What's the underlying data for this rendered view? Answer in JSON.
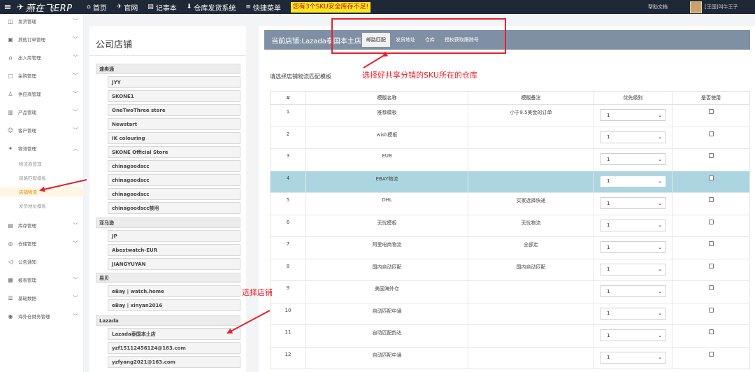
{
  "topbar": {
    "logo_text": "燕在飞ERP",
    "nav": [
      {
        "icon": "home-icon",
        "label": "首页"
      },
      {
        "icon": "paper-plane-icon",
        "label": "官网"
      },
      {
        "icon": "notebook-icon",
        "label": "记事本"
      },
      {
        "icon": "download-icon",
        "label": "仓库发货系统"
      },
      {
        "icon": "list-icon",
        "label": "快捷菜单"
      }
    ],
    "alert": "您有3个SKU安全库存不足!",
    "help": "帮助文档",
    "user": "[王国]叫牛王子"
  },
  "sidebar": {
    "items": [
      {
        "label": "发货管理",
        "icon": "truck-icon"
      },
      {
        "label": "其他订单管理",
        "icon": "order-icon"
      },
      {
        "label": "出入库管理",
        "icon": "box-icon"
      },
      {
        "label": "采购管理",
        "icon": "cart-icon"
      },
      {
        "label": "供应商管理",
        "icon": "supplier-icon"
      },
      {
        "label": "产品管理",
        "icon": "product-icon"
      },
      {
        "label": "客户管理",
        "icon": "customer-icon"
      },
      {
        "label": "物流管理",
        "icon": "logistics-icon"
      },
      {
        "label": "库存管理",
        "icon": "stock-icon"
      },
      {
        "label": "仓储管理",
        "icon": "warehouse-icon"
      },
      {
        "label": "公告通知",
        "icon": "megaphone-icon"
      },
      {
        "label": "报表管理",
        "icon": "report-icon"
      },
      {
        "label": "基础数据",
        "icon": "sliders-icon"
      },
      {
        "label": "海外仓财务管理",
        "icon": "finance-icon"
      }
    ],
    "subitems": [
      {
        "label": "物流商管理"
      },
      {
        "label": "邮路匹配模板"
      },
      {
        "label": "店铺物流"
      },
      {
        "label": "发货地址模板"
      }
    ]
  },
  "shop_panel": {
    "title": "公司店铺",
    "groups": [
      {
        "name": "速卖通",
        "shops": [
          "JYY",
          "SKONE1",
          "OneTwoThree store",
          "Newstart",
          "IK colouring",
          "SKONE Official Store",
          "chinagoodscc",
          "chinagoodscc",
          "chinagoodscc",
          "chinagoodscc禁用"
        ]
      },
      {
        "name": "亚马逊",
        "shops": [
          "JP",
          "Abestwatch-EUR",
          "JIANGYUYAN"
        ]
      },
      {
        "name": "易贝",
        "shops": [
          "eBay | watch.home",
          "eBay | xinyan2016"
        ]
      },
      {
        "name": "Lazada",
        "shops": [
          "Lazada泰国本土店",
          "yzf15112456124@163.com",
          "yzfyang2021@163.com"
        ]
      }
    ]
  },
  "main": {
    "current_shop": "当前店铺:Lazada泰国本土店",
    "tabs": [
      "邮路匹配",
      "发货地址",
      "仓库",
      "授权获取跟踪号"
    ],
    "hint": "请选择店铺物流匹配模板",
    "table": {
      "headers": [
        "#",
        "模版名称",
        "模版备注",
        "优先级别",
        "是否使用"
      ],
      "rows": [
        {
          "num": "1",
          "name": "推荐模板",
          "note": "小于9.5美金的订单",
          "priority": "1"
        },
        {
          "num": "2",
          "name": "wish模板",
          "note": "",
          "priority": "1"
        },
        {
          "num": "3",
          "name": "EUB",
          "note": "",
          "priority": "1"
        },
        {
          "num": "4",
          "name": "EBAY物流",
          "note": "",
          "priority": "1"
        },
        {
          "num": "5",
          "name": "DHL",
          "note": "买家选择快递",
          "priority": "1"
        },
        {
          "num": "6",
          "name": "无忧模板",
          "note": "无忧物流",
          "priority": "1"
        },
        {
          "num": "7",
          "name": "阿里电商物流",
          "note": "全部走",
          "priority": "1"
        },
        {
          "num": "8",
          "name": "国内自动匹配",
          "note": "国内自动匹配",
          "priority": "1"
        },
        {
          "num": "9",
          "name": "美国海外仓",
          "note": "",
          "priority": "1"
        },
        {
          "num": "10",
          "name": "自动匹配中通",
          "note": "",
          "priority": "1"
        },
        {
          "num": "11",
          "name": "自动匹配韵达",
          "note": "",
          "priority": "1"
        },
        {
          "num": "12",
          "name": "自动匹配中通",
          "note": "",
          "priority": "1"
        }
      ]
    }
  },
  "annotations": {
    "warehouse_hint": "选择好共享分销的SKU所在的仓库",
    "shop_hint": "选择店铺",
    "color": "#e8202a"
  }
}
